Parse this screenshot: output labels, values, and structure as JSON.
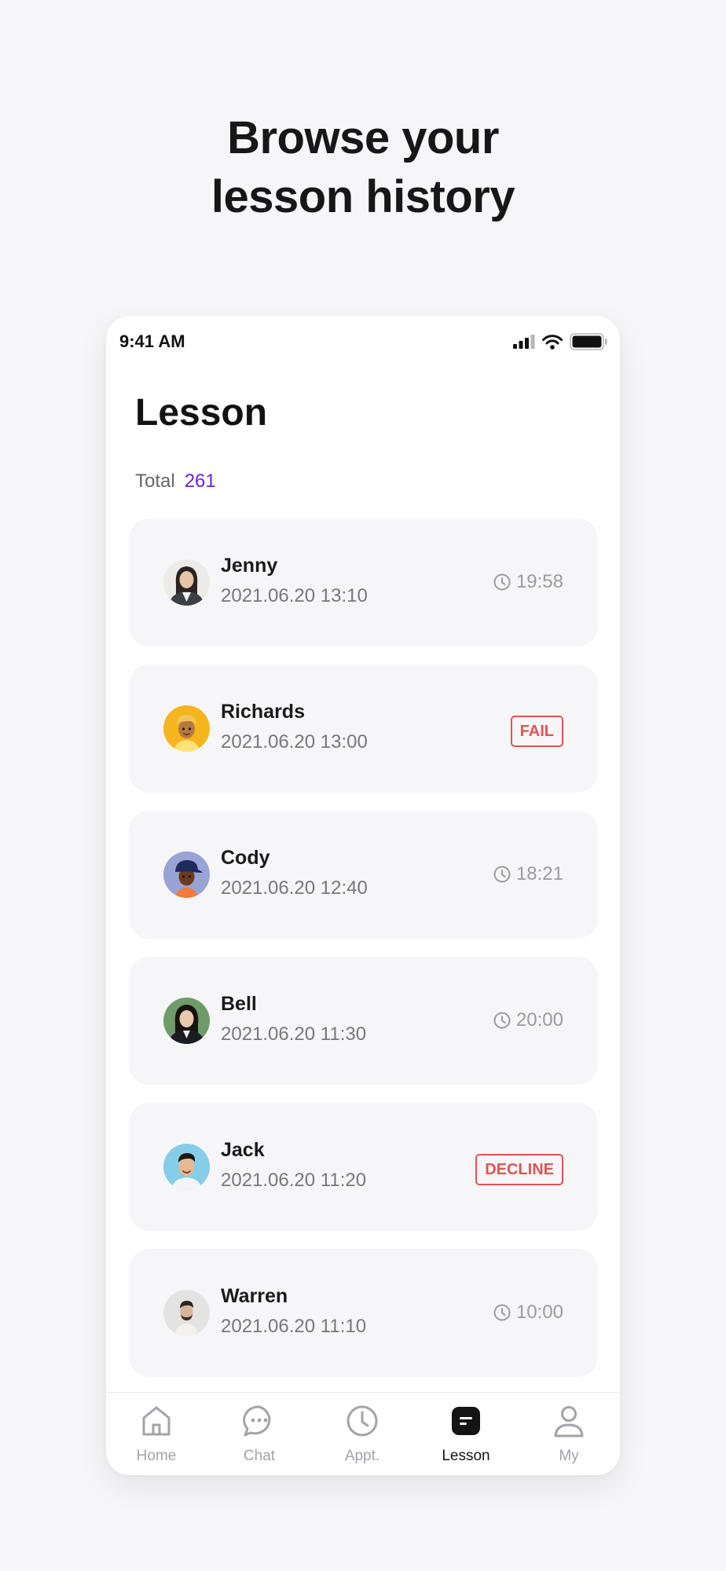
{
  "headline": {
    "line1": "Browse your",
    "line2": "lesson history"
  },
  "status_bar": {
    "time": "9:41 AM"
  },
  "page": {
    "title": "Lesson",
    "total_label": "Total",
    "total_count": "261"
  },
  "lessons": [
    {
      "name": "Jenny",
      "date": "2021.06.20 13:10",
      "duration": "19:58",
      "status": ""
    },
    {
      "name": "Richards",
      "date": "2021.06.20 13:00",
      "duration": "",
      "status": "FAIL"
    },
    {
      "name": "Cody",
      "date": "2021.06.20 12:40",
      "duration": "18:21",
      "status": ""
    },
    {
      "name": "Bell",
      "date": "2021.06.20 11:30",
      "duration": "20:00",
      "status": ""
    },
    {
      "name": "Jack",
      "date": "2021.06.20 11:20",
      "duration": "",
      "status": "DECLINE"
    },
    {
      "name": "Warren",
      "date": "2021.06.20 11:10",
      "duration": "10:00",
      "status": ""
    }
  ],
  "tabs": [
    {
      "label": "Home",
      "icon": "home-icon"
    },
    {
      "label": "Chat",
      "icon": "chat-icon"
    },
    {
      "label": "Appt.",
      "icon": "clock-icon"
    },
    {
      "label": "Lesson",
      "icon": "lesson-icon",
      "active": true
    },
    {
      "label": "My",
      "icon": "user-icon"
    }
  ],
  "colors": {
    "accent": "#6b1fe0",
    "status_badge": "#e35353",
    "card_bg": "#f6f6f8",
    "muted": "#9b9b9f"
  }
}
